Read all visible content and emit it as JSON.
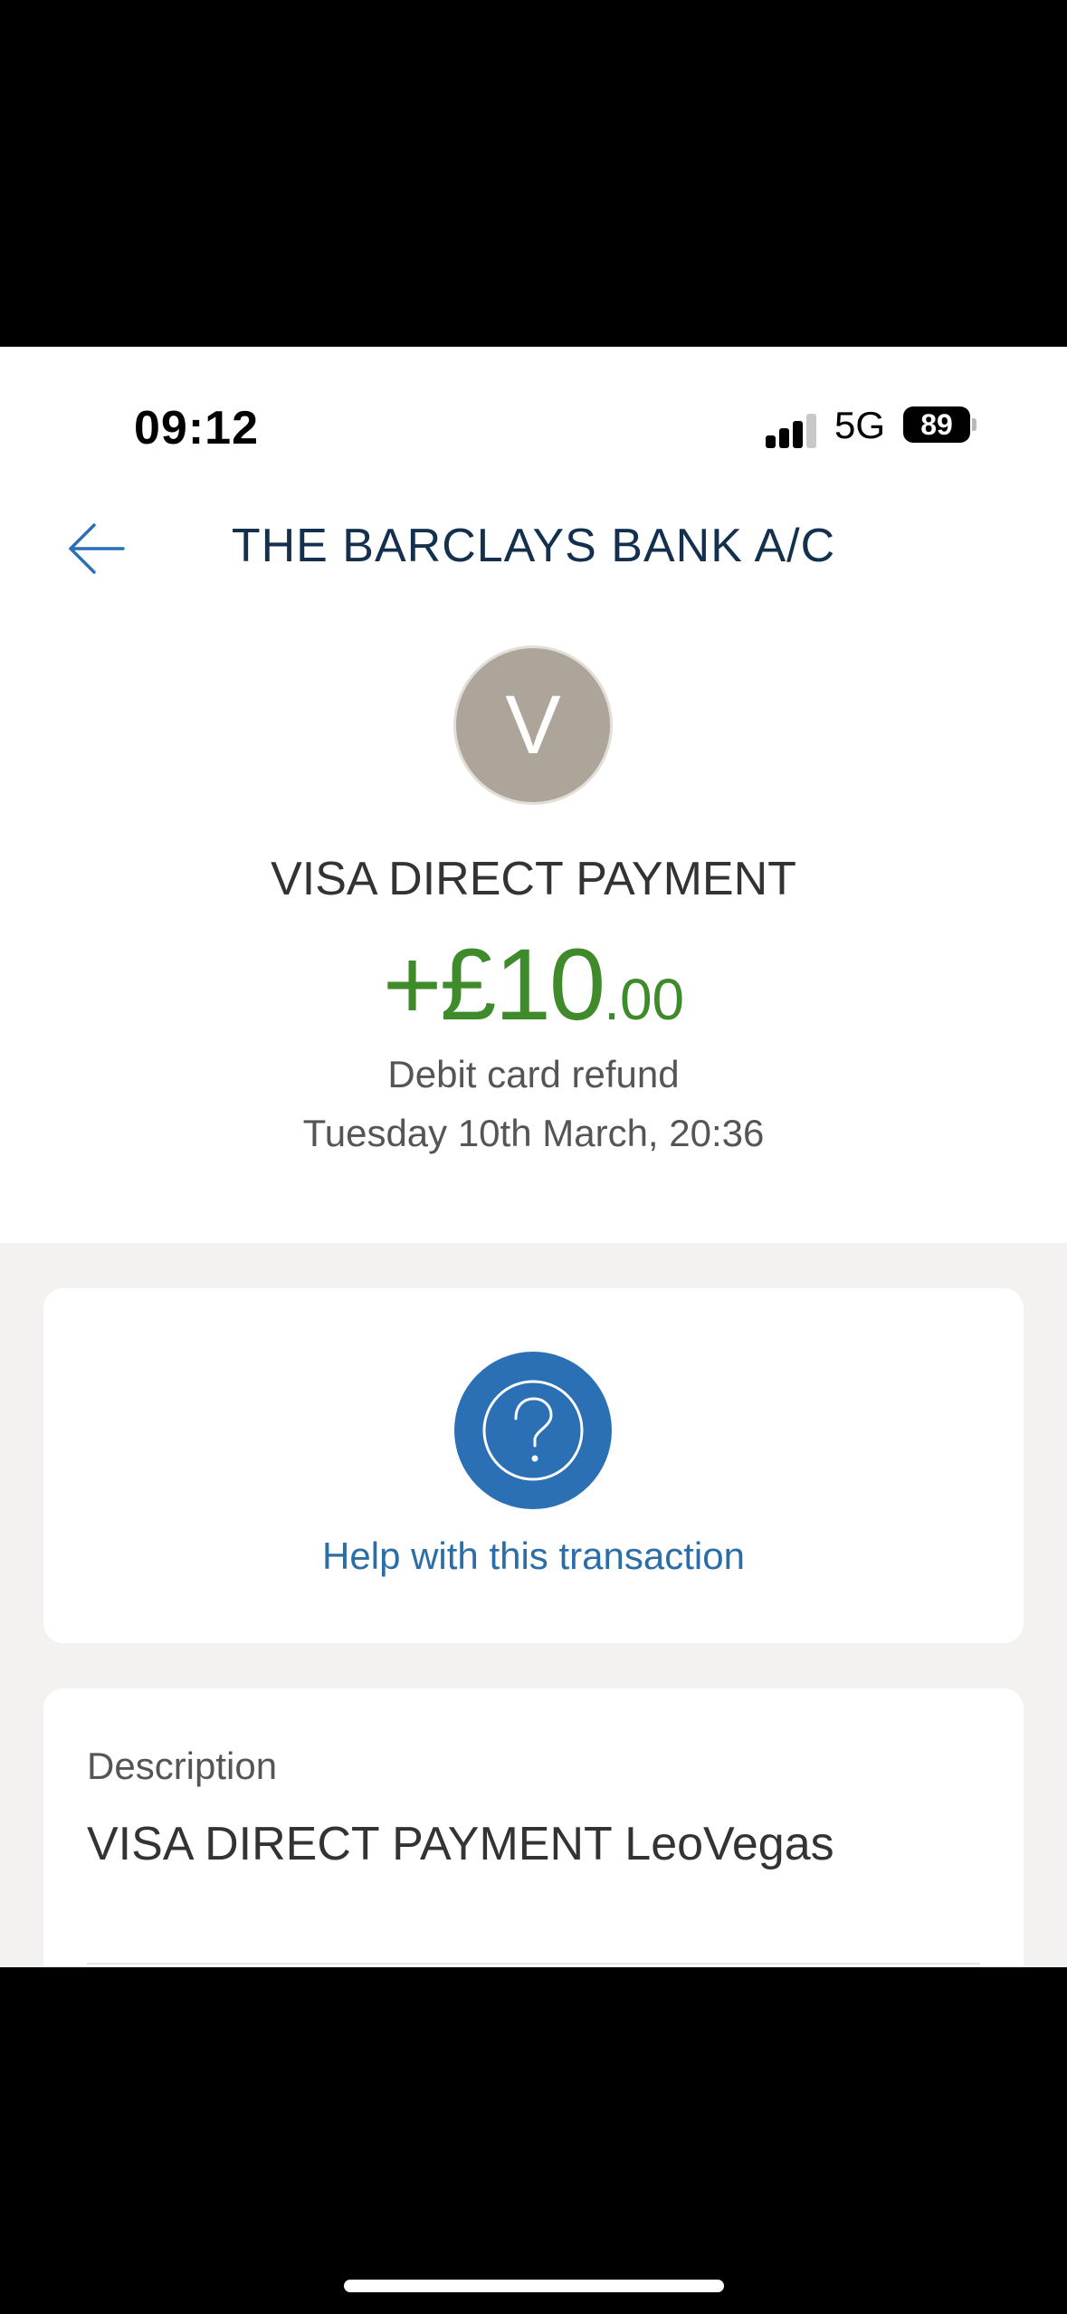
{
  "status_bar": {
    "time": "09:12",
    "network": "5G",
    "battery": "89"
  },
  "nav": {
    "title": "THE BARCLAYS BANK A/C"
  },
  "transaction": {
    "avatar_letter": "V",
    "merchant": "VISA DIRECT PAYMENT",
    "amount_main": "+£10",
    "amount_pence": ".00",
    "type": "Debit card refund",
    "datetime": "Tuesday 10th March, 20:36"
  },
  "help": {
    "label": "Help with this transaction"
  },
  "details": {
    "description_label": "Description",
    "description_value": "VISA DIRECT PAYMENT LeoVegas"
  },
  "colors": {
    "amount": "#3f8a2a",
    "accent": "#2b6fb5",
    "title": "#14304f"
  }
}
